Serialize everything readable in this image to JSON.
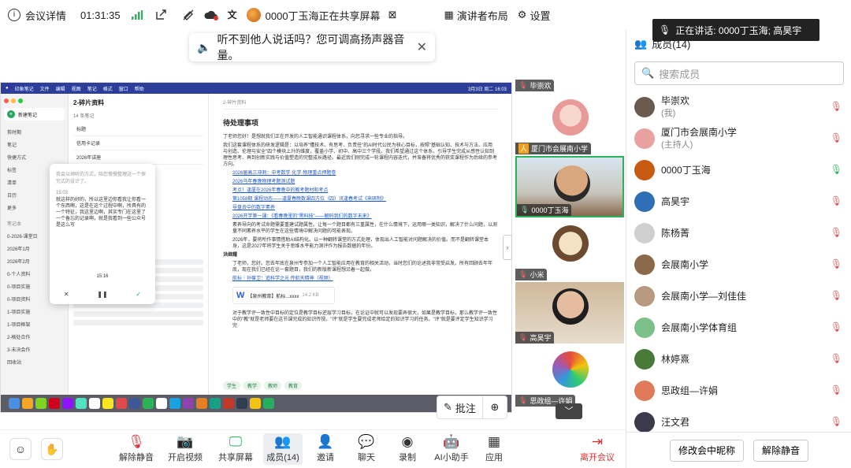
{
  "topbar": {
    "meeting_info": "会议详情",
    "timer": "01:31:35",
    "share_notice": "0000丁玉海正在共享屏幕",
    "presenter_layout": "演讲者布局",
    "settings": "设置"
  },
  "notice": {
    "text": "听不到他人说话吗？您可调高扬声器音量。"
  },
  "shared_screen": {
    "menubar": [
      "印象笔记",
      "文件",
      "编辑",
      "视图",
      "笔记",
      "格式",
      "窗口",
      "帮助"
    ],
    "menubar_clock": "3月3日 周二 16:03",
    "left_nav": {
      "new_note": "新建笔记",
      "items": [
        "剪时期",
        "笔记",
        "快捷方式",
        "标签",
        "清单",
        "日历",
        "更多"
      ],
      "notebook_header": "笔记本",
      "notebooks": [
        "0-2026-课堂日",
        "2026年1月",
        "2026年2月",
        "0-个人资料",
        "0-项目实施",
        "0-项目资料",
        "1-项目实施",
        "1-项目框架",
        "2-格处合作",
        "3-未决会作",
        "回收站"
      ]
    },
    "mid": {
      "title": "2-碎片资料",
      "count": "14 条笔记",
      "rows": [
        "标题",
        "信用卡记录",
        "2026年讲座"
      ]
    },
    "popup": {
      "hint": "我会以倾听的方式，陪您慢慢整理这一个探究式的设计了。",
      "time": "15:03",
      "body": "就这样的好的，所以这里边你看我让你看一个东西啊，这是在这个过程中啊，所具有的一个特征，我这里边啊，其实专门在这里了一个备忘的记录啊，就是我看到一些公众号是这么写",
      "clock": "15:16"
    },
    "doc": {
      "breadcrumb": "2-碎片资料",
      "title": "待处理事项",
      "intro": "丁老师您好！是想就我们正在开发的人工智能通识课程体系，向您寻求一些专业的指导。",
      "para1": "我们这套课程体系的研发逻辑是：以培养\"懂技术、有思考、负责任\"的AI时代公民为核心目标，按照\"基础认知、技术与方法、应用与创造、伦理与安全\"四个模块上升的维度，覆盖小学、初中、高中三个学段。我们希望通过这个体系，引导学生完成从感性认知到理性思考、再到创新实践与价值塑造的完整成长路径。最近我们刚完成一轮课程内容迭代，并准备将优秀的获奖课程作为后续的参考方向。",
      "links": [
        "2026届高三冲刺：中考数学·化学·物理重点押题卷",
        "2026马年春晚物理考题测试题",
        "考点！逢厦在2026年春晚中的教考题材和考点",
        "第1058期 课程动态——逢厦春晚数课四方位（四）讯逢春考试《来研制》",
        "导盘去中的数字素养",
        "2026开学第一课：《看春晚里的\"黑科技\"——解码我们的数字未来》"
      ],
      "bullet1": "素养导向的考试命题需要重建试题属性。让每一个题目都有三重属性，在什么情境下，运用哪一类知识，解决了什么问题，以测量不同素养水平的学生在这些情境中解决问题的可能表现。",
      "bullet2": "2026年，要将所作事情借助AI结构化。以一种翻转课堂的方式处理，体现出人工智能对问题解决的价值。而不是翻转课堂本身，这是2027年将学生关于思维水平能力测评作为报告数据的年份。",
      "section": "洪继耀",
      "bullet3": "丁老师，您好。您去年底在泉州专参加一个人工智能应用在教育的相关活动，当时您们的论述我非常受启发。所有回顾去年年底，现在我们已经在论一套题目，我们的新版新课程想沿着一起做。",
      "link_final": "航标｜孙葆卫：追科学之光 传航天精神（视频）",
      "attachment_name": "【泉州教育】航标...xxxx",
      "attachment_size": "14.2 KB",
      "bullet4": "对于教学评一致性中目标的定位是教学目标逆层学习目标，在论证中就可以发现要弄很大，如果是教学目标，那么教学评一致性中的\"教\"就是老师要在这节课完成的知识传授。\"评\"就是学生要完成老师给定的知识学习的任务。\"评\"就是要评定学生知识学习完",
      "tags": [
        "学生",
        "教学",
        "教师",
        "教育"
      ]
    },
    "annotate": "批注"
  },
  "videos": {
    "tiles": [
      {
        "name": "毕崇欢"
      },
      {
        "name": "厦门市会展南小学"
      },
      {
        "name": "0000丁玉海"
      },
      {
        "name": "小米"
      },
      {
        "name": "高昊宇"
      },
      {
        "name": "思政组—许娟"
      }
    ]
  },
  "speaker": {
    "text": "正在讲话: 0000丁玉海; 高昊宇"
  },
  "panel": {
    "title": "成员(14)",
    "search_placeholder": "搜索成员",
    "members": [
      {
        "name": "毕崇欢",
        "role": "(我)",
        "mic": "off",
        "color": "#6b5a50"
      },
      {
        "name": "厦门市会展南小学",
        "role": "(主持人)",
        "mic": "off",
        "color": "#e8a0a0"
      },
      {
        "name": "0000丁玉海",
        "role": "",
        "mic": "on",
        "color": "#c85a12"
      },
      {
        "name": "高昊宇",
        "role": "",
        "mic": "off",
        "color": "#2f6fb5"
      },
      {
        "name": "陈杨菁",
        "role": "",
        "mic": "off",
        "color": "#cfcfcf"
      },
      {
        "name": "会展南小学",
        "role": "",
        "mic": "off",
        "color": "#8a6a48"
      },
      {
        "name": "会展南小学—刘佳佳",
        "role": "",
        "mic": "off",
        "color": "#b89a80"
      },
      {
        "name": "会展南小学体育组",
        "role": "",
        "mic": "off",
        "color": "#7cc08a"
      },
      {
        "name": "林婷熹",
        "role": "",
        "mic": "off",
        "color": "#4a7a3a"
      },
      {
        "name": "思政组—许娟",
        "role": "",
        "mic": "off",
        "color": "#e07a5a"
      },
      {
        "name": "汪文君",
        "role": "",
        "mic": "off",
        "color": "#3a3a4a"
      }
    ],
    "rename_button": "修改会中昵称",
    "unmute_all_button": "解除静音"
  },
  "bottombar": {
    "unmute": "解除静音",
    "start_video": "开启视频",
    "share_screen": "共享屏幕",
    "members": "成员(14)",
    "invite": "邀请",
    "chat": "聊天",
    "record": "录制",
    "ai_assistant": "AI小助手",
    "apps": "应用",
    "leave": "离开会议"
  }
}
